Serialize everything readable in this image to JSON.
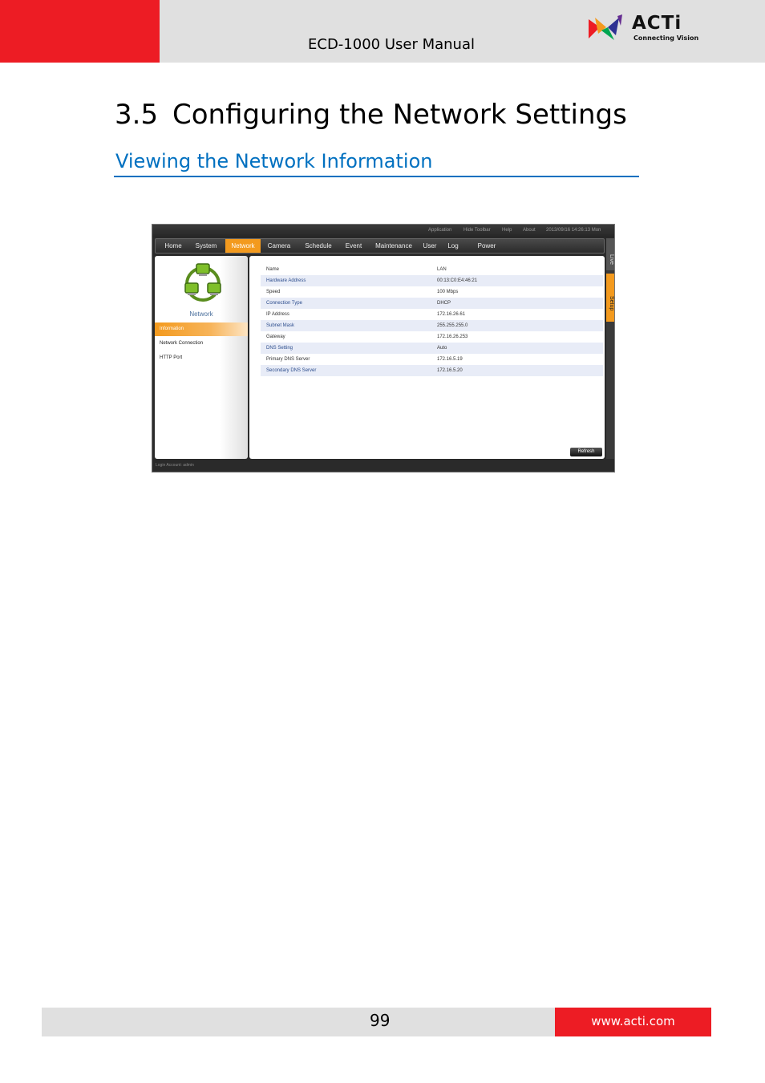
{
  "header": {
    "title": "ECD-1000 User Manual",
    "logo_name": "ACTi",
    "logo_tagline": "Connecting Vision",
    "colors": {
      "red": "#ed1c24",
      "gray": "#e0e0e0"
    }
  },
  "section": {
    "number": "3.5",
    "title": "Configuring the Network Settings",
    "subheading": "Viewing the Network Information",
    "heading_color": "#0070c0"
  },
  "screenshot": {
    "topbar": {
      "application": "Application",
      "hide_toolbar": "Hide Toolbar",
      "help": "Help",
      "about": "About",
      "datetime": "2013/09/16 14:26:13 Mon"
    },
    "nav": [
      "Home",
      "System",
      "Network",
      "Camera",
      "Schedule",
      "Event",
      "Maintenance",
      "User",
      "Log",
      "Power"
    ],
    "nav_active": "Network",
    "side_tabs": {
      "live": "Live",
      "setup": "Setup"
    },
    "left_panel": {
      "icon": "network-icon",
      "label": "Network",
      "items": [
        "Information",
        "Network Connection",
        "HTTP Port"
      ],
      "active_item": "Information"
    },
    "info_rows": [
      {
        "key": "Name",
        "value": "LAN"
      },
      {
        "key": "Hardware Address",
        "value": "00:13:C0:E4:46:21"
      },
      {
        "key": "Speed",
        "value": "100 Mbps"
      },
      {
        "key": "Connection Type",
        "value": "DHCP"
      },
      {
        "key": "IP Address",
        "value": "172.16.26.61"
      },
      {
        "key": "Subnet Mask",
        "value": "255.255.255.0"
      },
      {
        "key": "Gateway",
        "value": "172.16.26.253"
      },
      {
        "key": "DNS Setting",
        "value": "Auto"
      },
      {
        "key": "Primary DNS Server",
        "value": "172.16.5.19"
      },
      {
        "key": "Secondary DNS Server",
        "value": "172.16.5.20"
      }
    ],
    "refresh_label": "Refresh",
    "status": "Login Account: admin",
    "accent_color": "#f39a1e"
  },
  "footer": {
    "page_number": "99",
    "url": "www.acti.com"
  }
}
